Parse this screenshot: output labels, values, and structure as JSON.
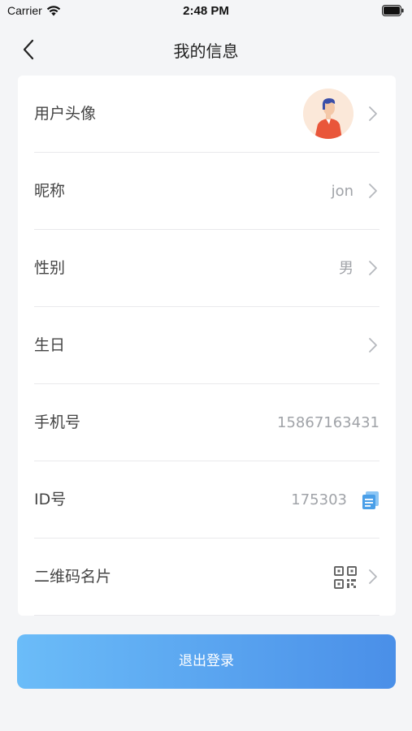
{
  "status_bar": {
    "carrier": "Carrier",
    "time": "2:48 PM"
  },
  "nav": {
    "title": "我的信息",
    "back_icon": "chevron-left-icon"
  },
  "rows": [
    {
      "label": "用户头像",
      "value": "",
      "icon": "avatar"
    },
    {
      "label": "昵称",
      "value": "jon",
      "icon": "chevron-right-icon"
    },
    {
      "label": "性别",
      "value": "男",
      "icon": "chevron-right-icon"
    },
    {
      "label": "生日",
      "value": "",
      "icon": "chevron-right-icon"
    },
    {
      "label": "手机号",
      "value": "15867163431",
      "icon": ""
    },
    {
      "label": "ID号",
      "value": "175303",
      "icon": "copy-icon"
    },
    {
      "label": "二维码名片",
      "value": "",
      "icon": "qr-code-icon"
    }
  ],
  "logout": {
    "label": "退出登录"
  },
  "colors": {
    "background": "#f4f5f7",
    "card": "#ffffff",
    "accent_start": "#6bbcf8",
    "accent_end": "#4a8fe8",
    "copy_icon": "#4a9fe8"
  }
}
